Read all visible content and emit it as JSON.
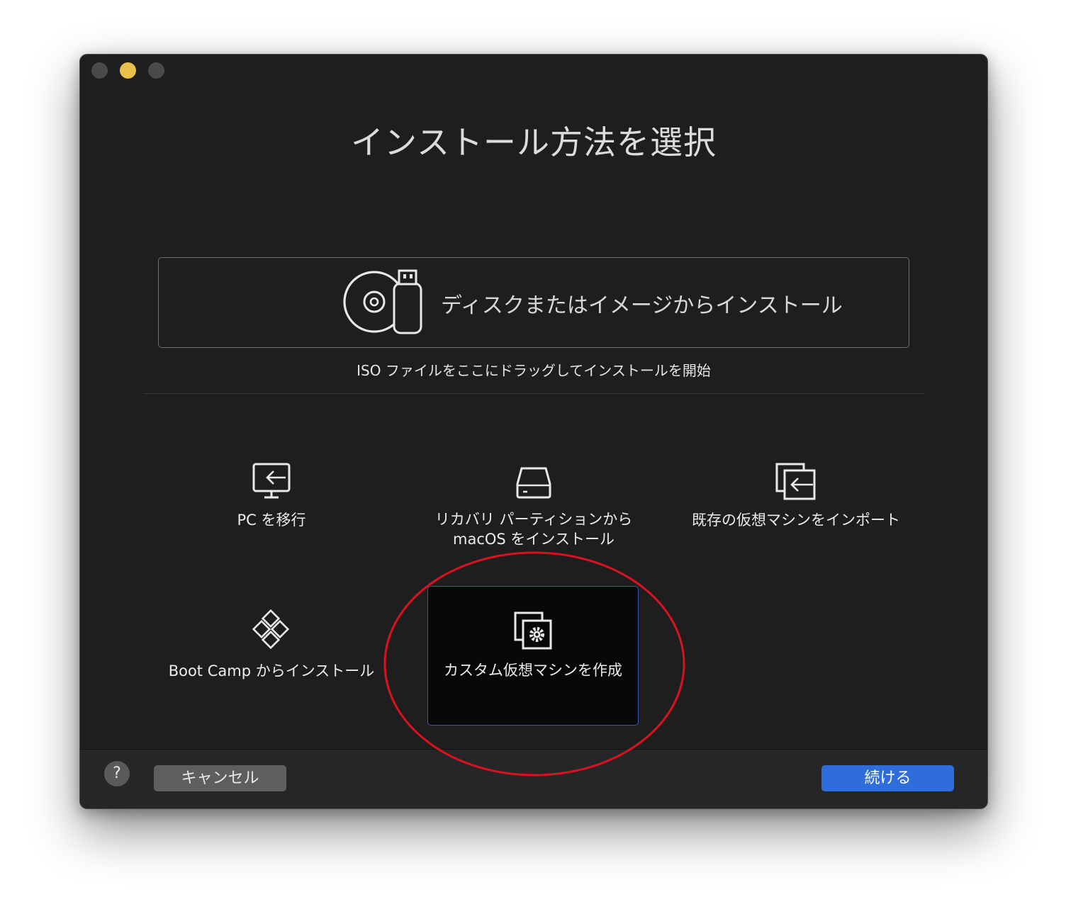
{
  "window": {
    "title": "インストール方法を選択"
  },
  "disk": {
    "label": "ディスクまたはイメージからインストール",
    "hint": "ISO ファイルをここにドラッグしてインストールを開始"
  },
  "options": {
    "pc": "PC を移行",
    "recovery_line1": "リカバリ パーティションから",
    "recovery_line2": "macOS をインストール",
    "import": "既存の仮想マシンをインポート",
    "bootcamp": "Boot Camp からインストール",
    "custom": "カスタム仮想マシンを作成"
  },
  "footer": {
    "help": "?",
    "cancel": "キャンセル",
    "continue": "続ける"
  },
  "colors": {
    "window_bg": "#1e1e1f",
    "selected_border": "#3e55b8",
    "continue_button": "#2f6ddb",
    "annotation_circle": "#d9121f",
    "minimize_dot": "#e8c04a"
  },
  "icons": {
    "disk": "disc-usb-icon",
    "pc": "monitor-arrow-icon",
    "recovery": "hard-drive-icon",
    "import": "import-vm-icon",
    "bootcamp": "bootcamp-diamond-icon",
    "custom": "custom-vm-gear-icon"
  }
}
